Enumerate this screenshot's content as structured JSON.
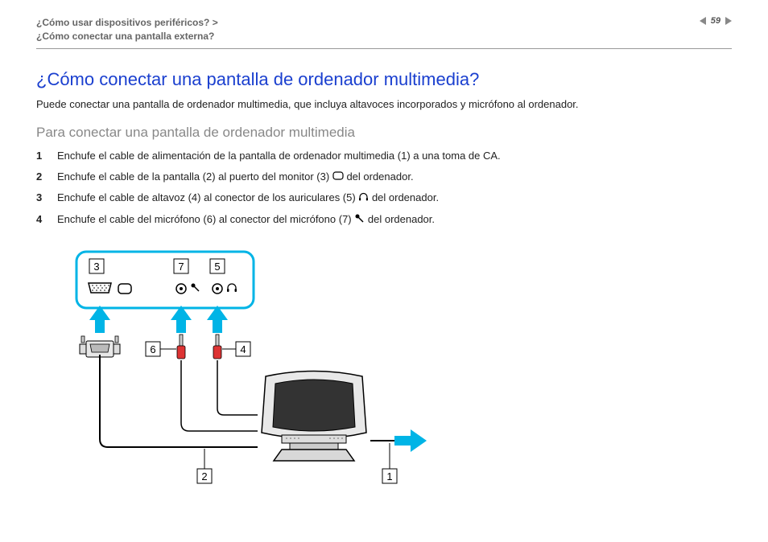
{
  "header": {
    "breadcrumb_line1": "¿Cómo usar dispositivos periféricos? >",
    "breadcrumb_line2": "¿Cómo conectar una pantalla externa?",
    "page_number": "59"
  },
  "title": "¿Cómo conectar una pantalla de ordenador multimedia?",
  "intro": "Puede conectar una pantalla de ordenador multimedia, que incluya altavoces incorporados y micrófono al ordenador.",
  "subheading": "Para conectar una pantalla de ordenador multimedia",
  "steps": [
    {
      "text_a": "Enchufe el cable de alimentación de la pantalla de ordenador multimedia (1) a una toma de CA.",
      "icon": null,
      "text_b": ""
    },
    {
      "text_a": "Enchufe el cable de la pantalla (2) al puerto del monitor (3) ",
      "icon": "monitor-port-icon",
      "text_b": " del ordenador."
    },
    {
      "text_a": "Enchufe el cable de altavoz (4) al conector de los auriculares (5) ",
      "icon": "headphones-icon",
      "text_b": " del ordenador."
    },
    {
      "text_a": "Enchufe el cable del micrófono (6) al conector del micrófono (7) ",
      "icon": "microphone-icon",
      "text_b": " del ordenador."
    }
  ],
  "diagram": {
    "labels": {
      "1": "1",
      "2": "2",
      "3": "3",
      "4": "4",
      "5": "5",
      "6": "6",
      "7": "7"
    }
  }
}
